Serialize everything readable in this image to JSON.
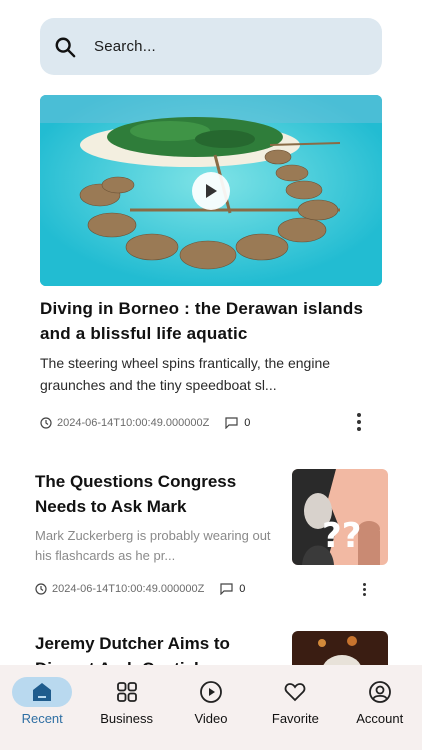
{
  "search": {
    "placeholder": "Search..."
  },
  "featured": {
    "title": "Diving in Borneo : the Derawan islands and a blissful life aquatic",
    "summary": "The steering wheel spins frantically, the engine graunches and the tiny speedboat sl...",
    "timestamp": "2024-06-14T10:00:49.000000Z",
    "comments": "0"
  },
  "articles": [
    {
      "title": "The Questions Congress Needs to Ask Mark",
      "summary": "Mark Zuckerberg is probably wearing out his flashcards as he pr...",
      "timestamp": "2024-06-14T10:00:49.000000Z",
      "comments": "0"
    },
    {
      "title": "Jeremy Dutcher Aims to Disrupt Arab Canticle"
    }
  ],
  "nav": {
    "items": [
      {
        "label": "Recent",
        "icon": "home-icon",
        "active": true
      },
      {
        "label": "Business",
        "icon": "grid-icon",
        "active": false
      },
      {
        "label": "Video",
        "icon": "play-circle-icon",
        "active": false
      },
      {
        "label": "Favorite",
        "icon": "heart-icon",
        "active": false
      },
      {
        "label": "Account",
        "icon": "account-icon",
        "active": false
      }
    ]
  },
  "colors": {
    "accent": "#2f6fa3",
    "active_pill": "#b9d9ef",
    "search_bg": "#dde8f0",
    "tabbar_bg": "#f6f0ef"
  }
}
